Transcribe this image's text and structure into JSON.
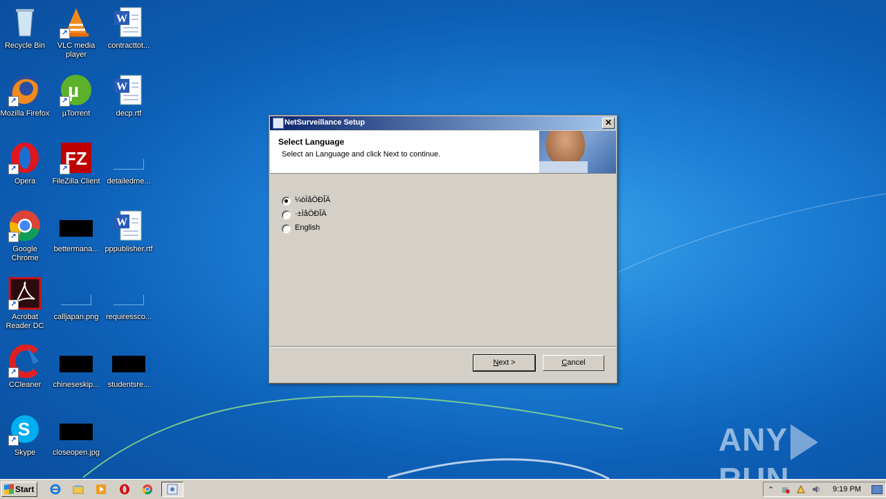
{
  "desktop": {
    "icons": [
      {
        "label": "Recycle Bin",
        "icon": "recycle-bin-icon"
      },
      {
        "label": "VLC media player",
        "icon": "vlc-icon"
      },
      {
        "label": "contracttot...",
        "icon": "word-doc-icon"
      },
      {
        "label": "Mozilla Firefox",
        "icon": "firefox-icon"
      },
      {
        "label": "µTorrent",
        "icon": "utorrent-icon"
      },
      {
        "label": "decp.rtf",
        "icon": "word-doc-icon"
      },
      {
        "label": "Opera",
        "icon": "opera-icon"
      },
      {
        "label": "FileZilla Client",
        "icon": "filezilla-icon"
      },
      {
        "label": "detailedme...",
        "icon": "blank-file-icon"
      },
      {
        "label": "Google Chrome",
        "icon": "chrome-icon"
      },
      {
        "label": "bettermana...",
        "icon": "black-image-icon"
      },
      {
        "label": "pppublisher.rtf",
        "icon": "word-doc-icon"
      },
      {
        "label": "Acrobat Reader DC",
        "icon": "acrobat-icon"
      },
      {
        "label": "calljapan.png",
        "icon": "blank-file-icon"
      },
      {
        "label": "requiressco...",
        "icon": "blank-file-icon"
      },
      {
        "label": "CCleaner",
        "icon": "ccleaner-icon"
      },
      {
        "label": "chineseskip...",
        "icon": "black-image-icon"
      },
      {
        "label": "studentsre...",
        "icon": "black-image-icon"
      },
      {
        "label": "Skype",
        "icon": "skype-icon"
      },
      {
        "label": "closeopen.jpg",
        "icon": "black-image-icon"
      }
    ]
  },
  "dialog": {
    "title": "NetSurveillance Setup",
    "close_glyph": "✕",
    "header_title": "Select Language",
    "header_subtitle": "Select an Language and click Next to continue.",
    "options": [
      {
        "label": "¼òÌåÖÐÎÄ",
        "selected": true
      },
      {
        "label": "·±ÌåÖÐÎÄ",
        "selected": false
      },
      {
        "label": "English",
        "selected": false
      }
    ],
    "next_button": {
      "mnemonic": "N",
      "rest": "ext >"
    },
    "cancel_button": {
      "mnemonic": "C",
      "rest": "ancel"
    }
  },
  "taskbar": {
    "start_label": "Start",
    "quick_launch": [
      "ie-icon",
      "explorer-icon",
      "media-player-icon",
      "opera-icon",
      "chrome-icon"
    ],
    "active_task_icon": "setup-icon",
    "tray_icons": [
      "show-hidden-icon",
      "network-error-icon",
      "action-center-icon",
      "volume-icon"
    ],
    "clock": "9:19 PM"
  },
  "watermark": {
    "left": "ANY",
    "right": "RUN"
  },
  "colors": {
    "titlebar_start": "#0a246a",
    "titlebar_end": "#a6caf0",
    "dialog_bg": "#d4d0c8"
  }
}
